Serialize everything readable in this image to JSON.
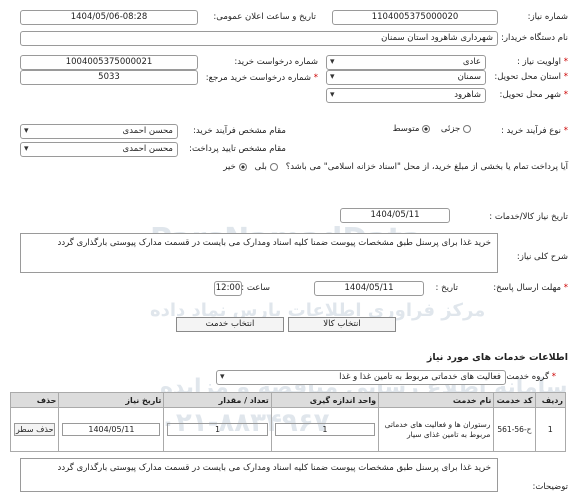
{
  "need_number": {
    "label": "شماره نیاز:",
    "value": "1104005375000020"
  },
  "announce_datetime": {
    "label": "تاریخ و ساعت اعلان عمومی:",
    "value": "1404/05/06-08:28"
  },
  "buyer_org": {
    "label": "نام دستگاه خریدار:",
    "value": "شهرداری شاهرود استان سمنان"
  },
  "request_number": {
    "label": "شماره درخواست خرید:",
    "value": "1004005375000021"
  },
  "reference_number": {
    "label": "شماره درخواست خرید مرجع:",
    "value": "5033"
  },
  "priority": {
    "label": "اولویت نیاز :",
    "value": "عادی"
  },
  "delivery_province": {
    "label": "استان محل تحویل:",
    "value": "سمنان"
  },
  "delivery_city": {
    "label": "شهر محل تحویل:",
    "value": "شاهرود"
  },
  "process_type": {
    "label": "نوع فرآیند خرید :",
    "options": [
      "جزئی",
      "متوسط"
    ],
    "selected": "متوسط"
  },
  "process_official": {
    "label": "مقام مشخص فرآیند خرید:",
    "value": "محسن احمدی"
  },
  "payment_official": {
    "label": "مقام مشخص تایید پرداخت:",
    "value": "محسن احمدی"
  },
  "treasury_question": {
    "text": "آیا پرداخت تمام یا بخشی از مبلغ خرید، از محل \"اسناد خزانه اسلامی\" می باشد؟",
    "yes": "بلی",
    "no": "خیر",
    "selected": "خیر"
  },
  "min_validity": {
    "label": "تاریخ نیاز کالا/خدمات :",
    "value": "1404/05/11"
  },
  "description": {
    "label": "شرح کلی نیاز:",
    "value": "خرید غذا برای پرسنل طبق مشخصات پیوست ضمنا کلیه اسناد ومدارک می بایست در قسمت مدارک پیوستی بارگذاری گردد"
  },
  "response_deadline": {
    "label": "مهلت ارسال پاسخ:",
    "date_label": "تاریخ :",
    "date": "1404/05/11",
    "time_label": "ساعت :",
    "time": "12:00"
  },
  "tabs": {
    "goods": "انتخاب کالا",
    "services": "انتخاب خدمت"
  },
  "services_section": {
    "title": "اطلاعات خدمات های مورد نیاز",
    "group_label": "گروه خدمت :",
    "group_value": "فعالیت های خدماتی مربوط به تامین غذا و غذا",
    "columns": [
      "ردیف",
      "کد خدمت",
      "نام خدمت",
      "واحد اندازه گیری",
      "تعداد / مقدار",
      "تاریخ نیاز",
      "حذف"
    ],
    "rows": [
      {
        "row": "1",
        "code": "ح-56-561",
        "name": "رستوران ها و فعالیت های خدماتی مربوط به تامین غذای سیار",
        "unit": "1",
        "qty": "1",
        "date": "1404/05/11",
        "delete": "حذف سطر"
      }
    ]
  },
  "notes": {
    "label": "توضیحات:",
    "value": "خرید غذا برای پرسنل طبق مشخصات پیوست ضمنا کلیه اسناد ومدارک می بایست در قسمت مدارک پیوستی بارگذاری گردد"
  },
  "watermark": {
    "brand": "ParsNamadData",
    "line1": "مرکز فراوری اطلاعات پارس نماد داده",
    "line2": "سامانه اطلاع رسانی مناقصه و مزایده",
    "phone": "۰۲۱-۸۸۳۴۹۶۷"
  }
}
